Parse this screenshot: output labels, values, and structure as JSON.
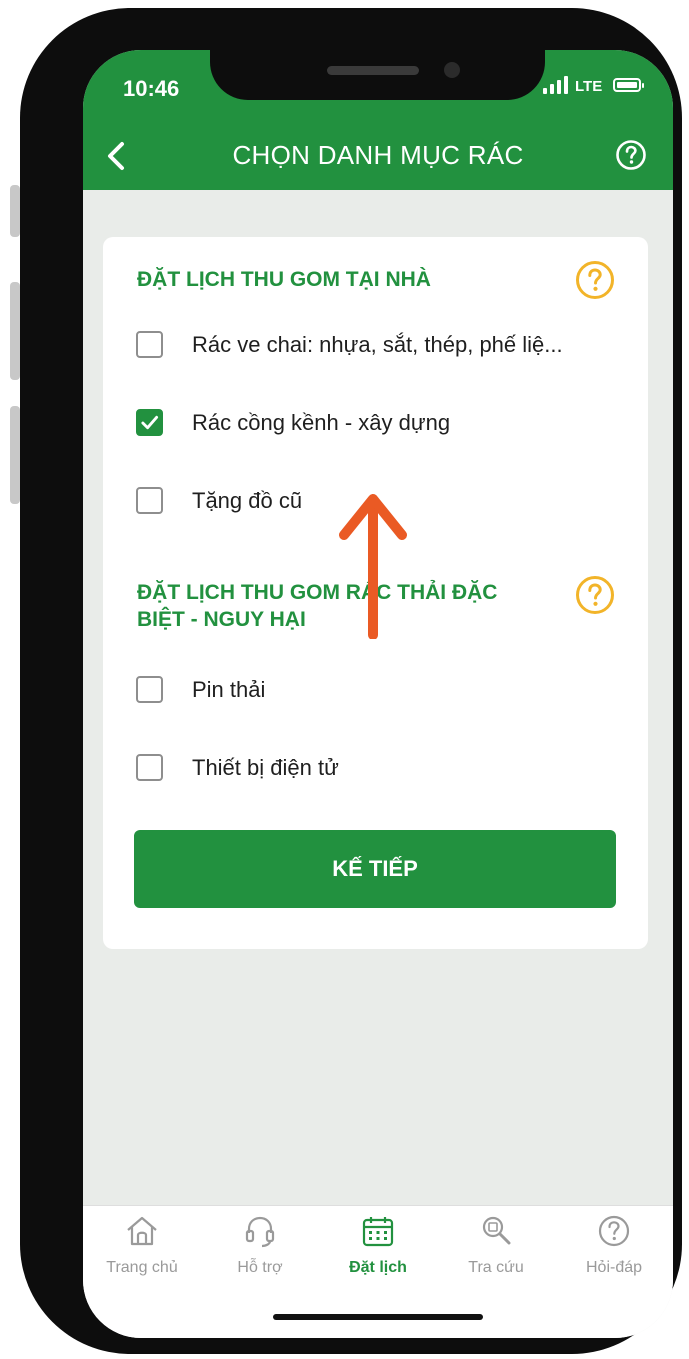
{
  "status_bar": {
    "time": "10:46",
    "network": "LTE"
  },
  "header": {
    "title": "CHỌN DANH MỤC RÁC"
  },
  "sections": [
    {
      "title": "ĐẶT LỊCH THU GOM TẠI NHÀ",
      "options": [
        {
          "label": "Rác ve chai: nhựa, sắt, thép, phế liệ...",
          "checked": false
        },
        {
          "label": "Rác cồng kềnh - xây dựng",
          "checked": true
        },
        {
          "label": "Tặng đồ cũ",
          "checked": false
        }
      ]
    },
    {
      "title_line1": "ĐẶT LỊCH THU GOM RÁC THẢI ĐẶC",
      "title_line2": "BIỆT - NGUY HẠI",
      "options": [
        {
          "label": "Pin thải",
          "checked": false
        },
        {
          "label": "Thiết bị điện tử",
          "checked": false
        }
      ]
    }
  ],
  "next_button": "KẾ TIẾP",
  "tabs": [
    {
      "label": "Trang chủ",
      "icon": "home-icon"
    },
    {
      "label": "Hỗ trợ",
      "icon": "headset-icon"
    },
    {
      "label": "Đặt lịch",
      "icon": "calendar-icon",
      "active": true
    },
    {
      "label": "Tra cứu",
      "icon": "search-icon"
    },
    {
      "label": "Hỏi-đáp",
      "icon": "question-icon"
    }
  ],
  "colors": {
    "brand_green": "#22913f",
    "info_yellow": "#f2b429",
    "annotation_arrow": "#ea5a24"
  }
}
